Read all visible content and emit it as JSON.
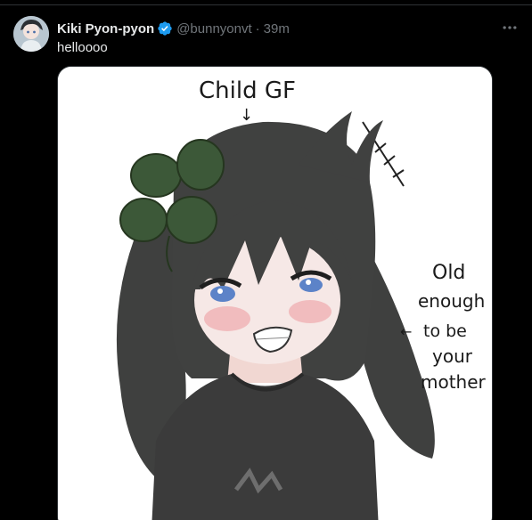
{
  "tweet": {
    "display_name": "Kiki Pyon-pyon",
    "handle": "@bunnyonvt",
    "separator": "·",
    "time": "39m",
    "text": "helloooo"
  },
  "media": {
    "caption_top": "Child GF",
    "caption_arrow": "↓",
    "caption_side_lines": [
      "Old",
      "enough",
      "to be",
      "your",
      "mother"
    ],
    "caption_side_arrow": "←"
  },
  "colors": {
    "background": "#000000",
    "text_primary": "#e7e9ea",
    "text_secondary": "#71767b",
    "verified": "#1d9bf0",
    "divider": "#2f3336"
  },
  "icons": {
    "verified": "verified-badge-icon",
    "more": "more-options-icon"
  }
}
